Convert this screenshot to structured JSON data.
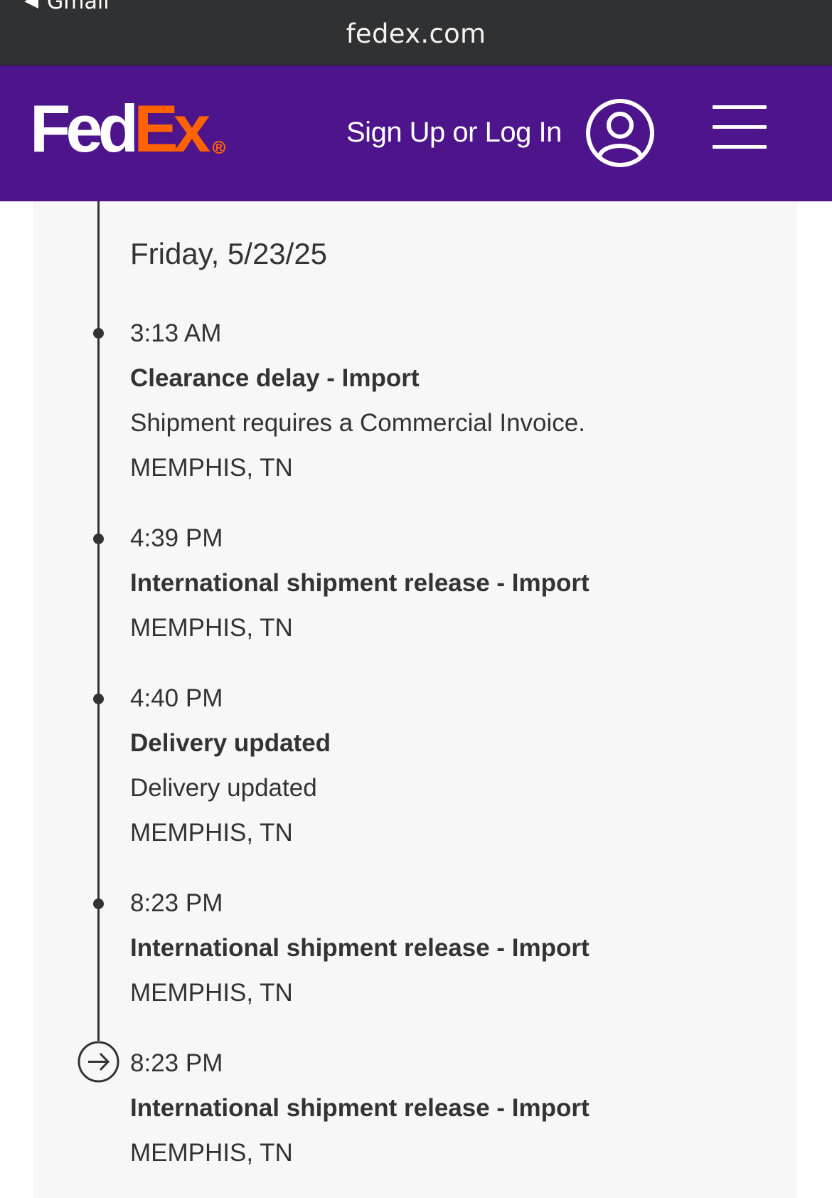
{
  "browser": {
    "back_label": "Gmail",
    "url": "fedex.com"
  },
  "header": {
    "logo_fed": "Fed",
    "logo_ex": "Ex",
    "logo_reg": "R",
    "sign_in_label": "Sign Up or Log In",
    "brand_purple": "#4d148c",
    "brand_orange": "#ff6200"
  },
  "timeline": {
    "date": "Friday, 5/23/25",
    "events": [
      {
        "time": "3:13 AM",
        "title": "Clearance delay - Import",
        "description": "Shipment requires a Commercial Invoice.",
        "location": "MEMPHIS, TN"
      },
      {
        "time": "4:39 PM",
        "title": "International shipment release - Import",
        "location": "MEMPHIS, TN"
      },
      {
        "time": "4:40 PM",
        "title": "Delivery updated",
        "description": "Delivery updated",
        "location": "MEMPHIS, TN"
      },
      {
        "time": "8:23 PM",
        "title": "International shipment release - Import",
        "location": "MEMPHIS, TN"
      },
      {
        "time": "8:23 PM",
        "title": "International shipment release - Import",
        "location": "MEMPHIS, TN"
      }
    ]
  }
}
